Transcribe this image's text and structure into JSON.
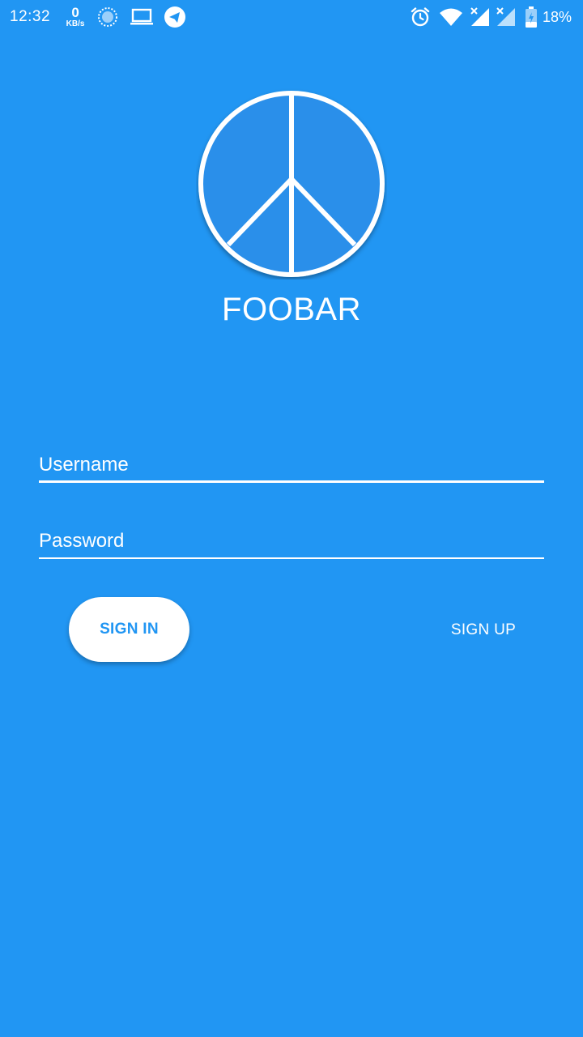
{
  "status_bar": {
    "time": "12:32",
    "net_speed_value": "0",
    "net_speed_unit": "KB/s",
    "battery_percent": "18%"
  },
  "app": {
    "title": "FOOBAR"
  },
  "form": {
    "username_placeholder": "Username",
    "password_placeholder": "Password",
    "sign_in_label": "SIGN IN",
    "sign_up_label": "SIGN UP"
  },
  "colors": {
    "background": "#2196F3",
    "accent": "#2196F3",
    "foreground": "#ffffff"
  },
  "icons": [
    "aperture-icon",
    "laptop-icon",
    "telegram-icon",
    "alarm-icon",
    "wifi-icon",
    "signal-icon",
    "signal-icon",
    "battery-charging-icon",
    "peace-logo"
  ]
}
